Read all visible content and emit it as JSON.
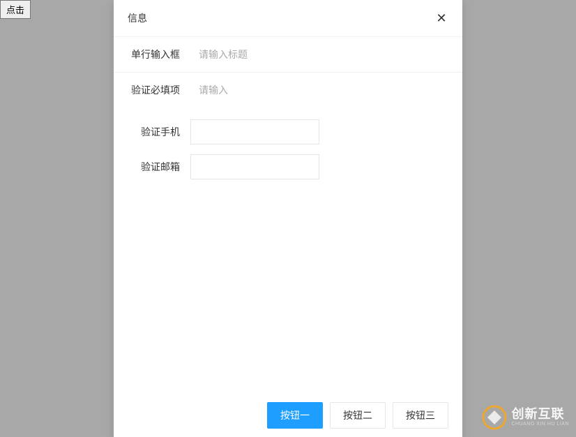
{
  "background": {
    "button_label": "点击"
  },
  "modal": {
    "title": "信息",
    "close_icon": "✕",
    "fields": {
      "single_line": {
        "label": "单行输入框",
        "placeholder": "请输入标题"
      },
      "required": {
        "label": "验证必填项",
        "placeholder": "请输入"
      },
      "phone": {
        "label": "验证手机"
      },
      "email": {
        "label": "验证邮箱"
      }
    },
    "footer": {
      "btn1": "按钮一",
      "btn2": "按钮二",
      "btn3": "按钮三"
    }
  },
  "watermark": {
    "main": "创新互联",
    "sub": "CHUANG XIN HU LIAN"
  }
}
